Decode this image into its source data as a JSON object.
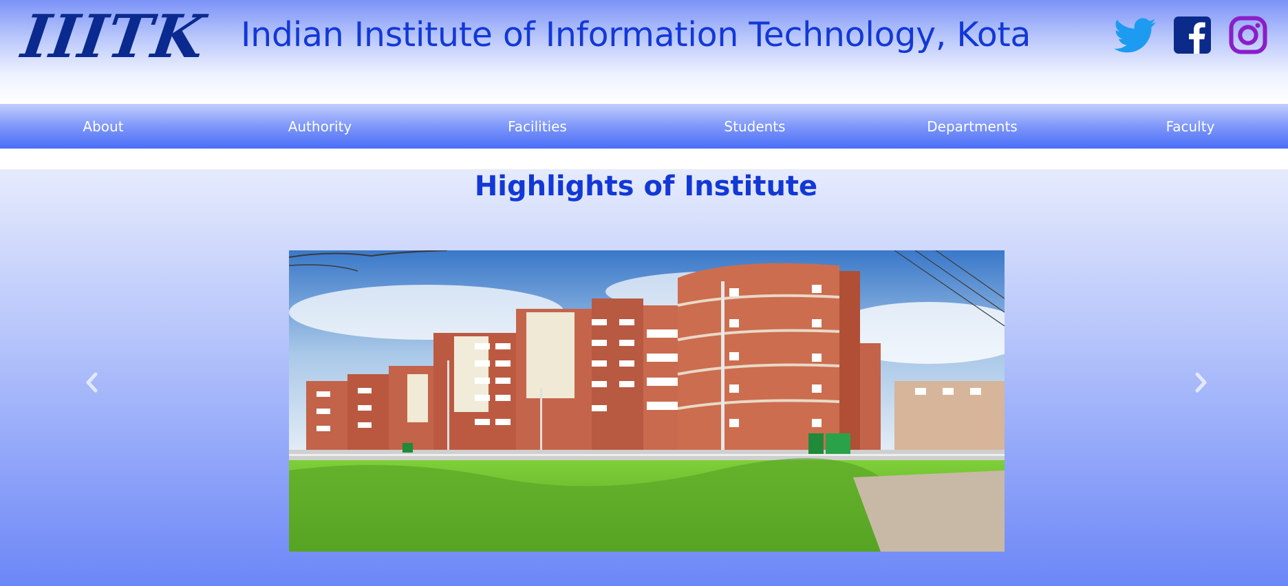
{
  "header": {
    "logo_text": "IIITK",
    "title": "Indian Institute of Information Technology, Kota",
    "social": [
      {
        "name": "twitter-icon",
        "color": "#1d9bf0"
      },
      {
        "name": "facebook-icon",
        "color": "#0b2a8a"
      },
      {
        "name": "instagram-icon",
        "color": "#8a1fc8"
      }
    ]
  },
  "nav": {
    "items": [
      "About",
      "Authority",
      "Facilities",
      "Students",
      "Departments",
      "Faculty"
    ]
  },
  "highlights": {
    "title": "Highlights of Institute",
    "carousel": {
      "prev_icon": "chevron-left-icon",
      "next_icon": "chevron-right-icon",
      "image_description": "campus-building-photo"
    }
  },
  "colors": {
    "title_blue": "#1238d6",
    "logo_navy": "#0a2a8f",
    "nav_text": "#ffffff"
  }
}
